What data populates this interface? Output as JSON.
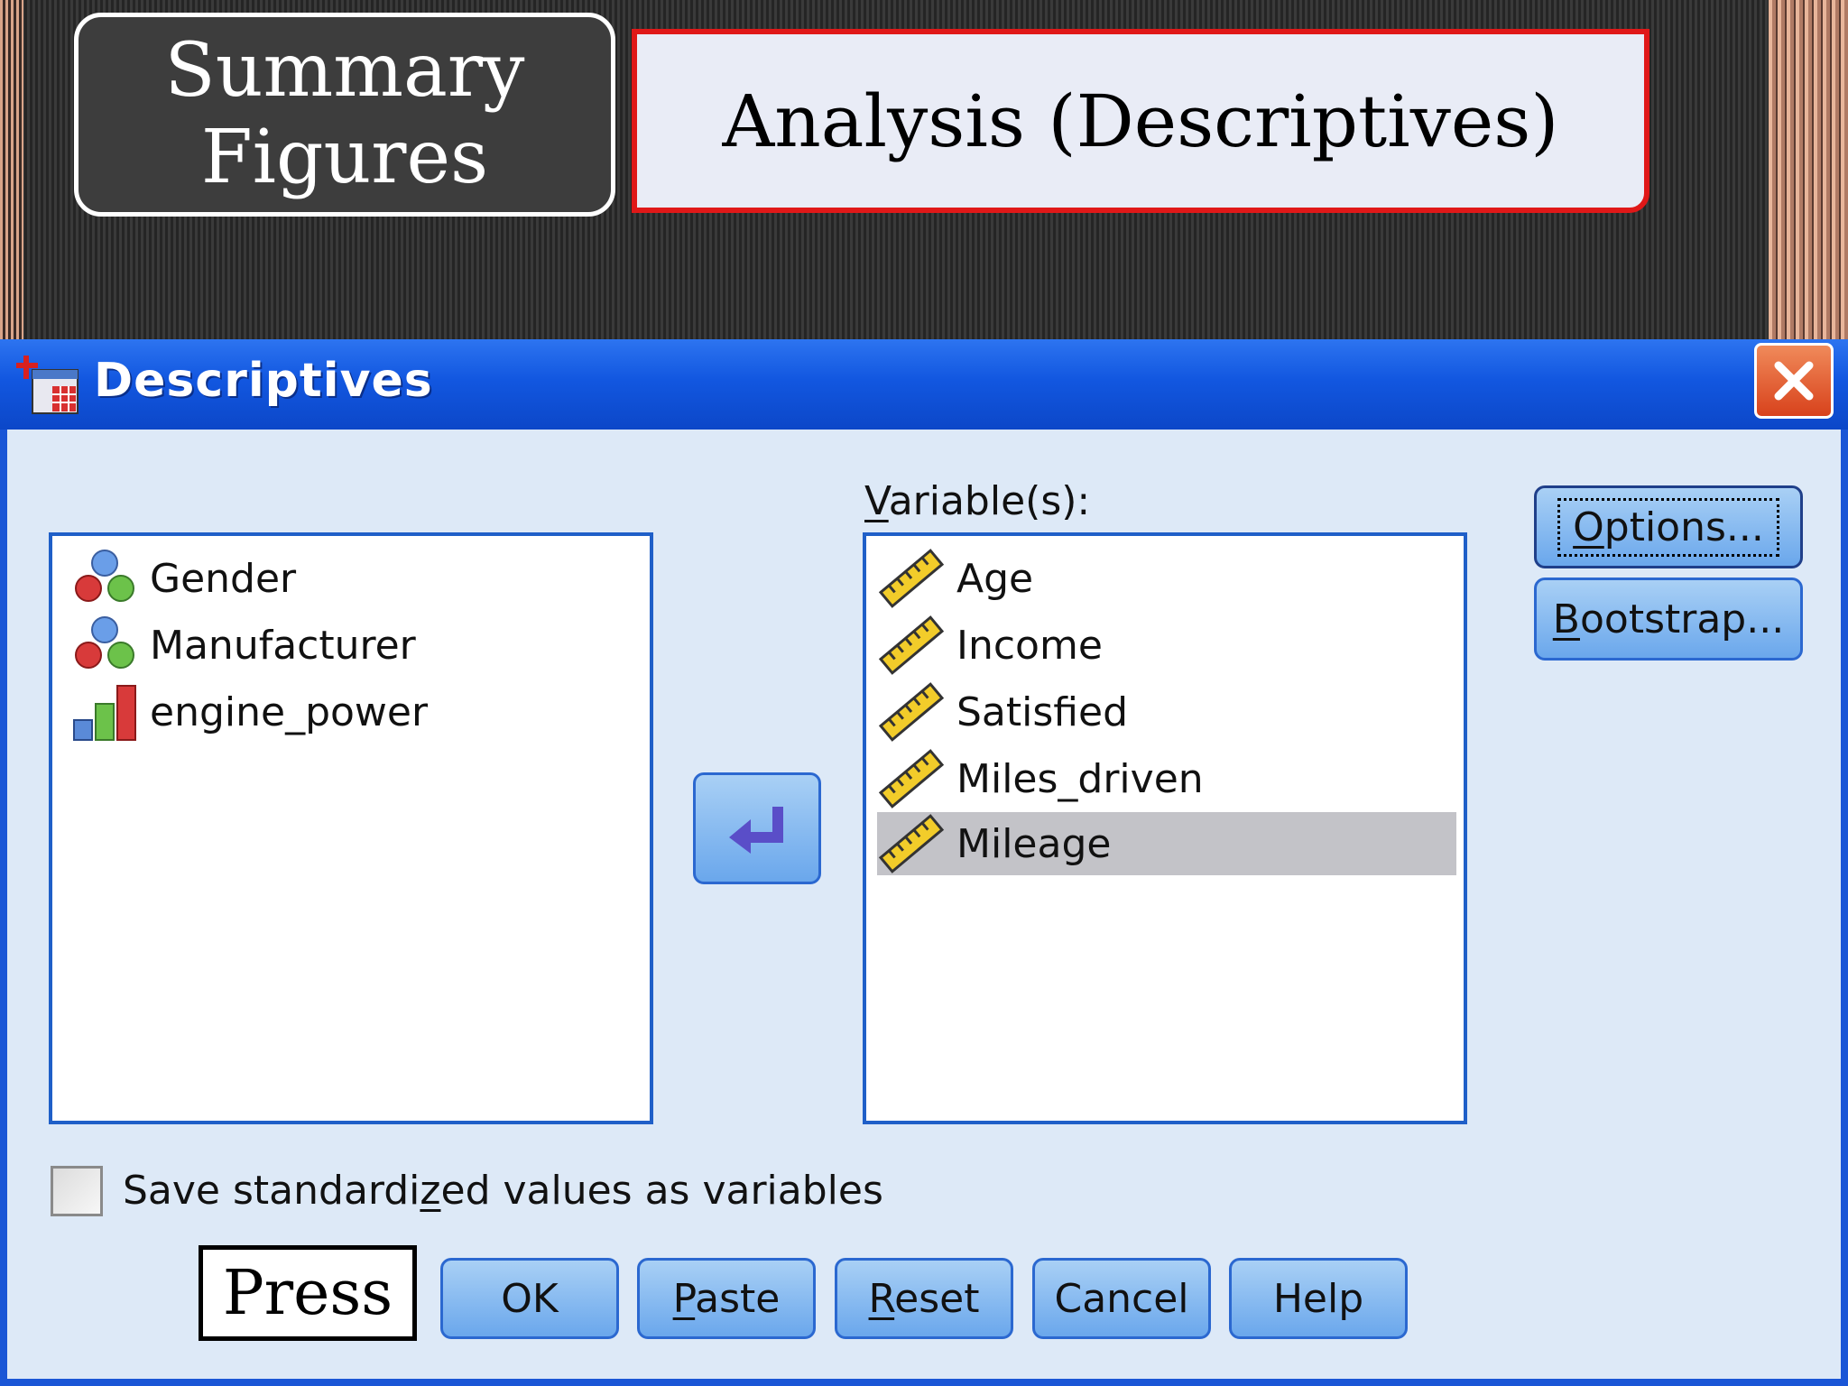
{
  "slide": {
    "summary_label_line1": "Summary",
    "summary_label_line2": "Figures",
    "heading": "Analysis (Descriptives)",
    "press_label": "Press"
  },
  "dialog": {
    "title": "Descriptives",
    "source_variables": [
      {
        "label": "Gender",
        "icon": "nominal-icon"
      },
      {
        "label": "Manufacturer",
        "icon": "nominal-icon"
      },
      {
        "label": "engine_power",
        "icon": "ordinal-icon"
      }
    ],
    "variables_label_underlined": "V",
    "variables_label_rest": "ariable(s):",
    "target_variables": [
      {
        "label": "Age",
        "icon": "scale-ruler-icon"
      },
      {
        "label": "Income",
        "icon": "scale-ruler-icon"
      },
      {
        "label": "Satisfied",
        "icon": "scale-ruler-icon"
      },
      {
        "label": "Miles_driven",
        "icon": "scale-ruler-icon"
      },
      {
        "label": "Mileage",
        "icon": "scale-ruler-icon",
        "selected": true
      }
    ],
    "options_button": {
      "underlined": "O",
      "rest": "ptions..."
    },
    "bootstrap_button": {
      "underlined": "B",
      "rest": "ootstrap..."
    },
    "checkbox": {
      "label_before": "Save standardi",
      "label_underlined": "z",
      "label_after": "ed values as variables",
      "checked": false
    },
    "buttons": {
      "ok": "OK",
      "paste": {
        "underlined": "P",
        "rest": "aste"
      },
      "reset": {
        "underlined": "R",
        "rest": "eset"
      },
      "cancel": "Cancel",
      "help": "Help"
    }
  },
  "colors": {
    "titlebar": "#1257e0",
    "dialog_bg": "#dde9f7",
    "button": "#6aa7ec",
    "heading_border": "#e01818",
    "selection": "#c3c3c8"
  }
}
